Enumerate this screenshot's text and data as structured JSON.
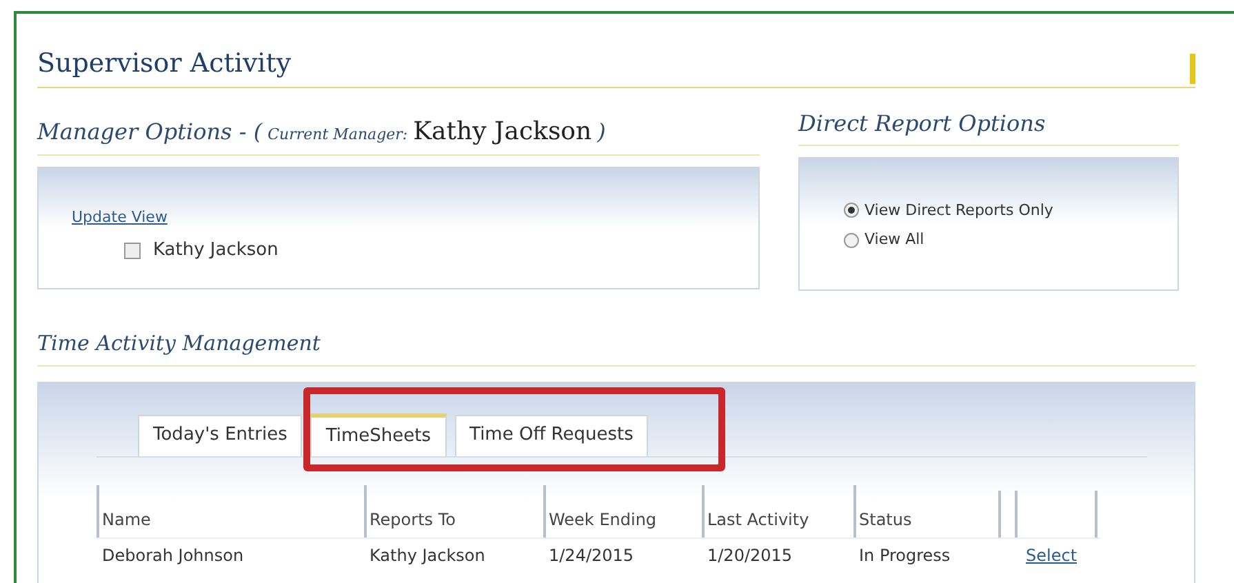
{
  "title": "Supervisor Activity",
  "manager_options": {
    "heading": "Manager Options - (",
    "current_label": "Current Manager:",
    "current_name": "Kathy Jackson",
    "close": ")",
    "link": "Update View",
    "managers": [
      {
        "label": "Kathy Jackson",
        "checked": false
      }
    ]
  },
  "direct_report_options": {
    "heading": "Direct Report Options",
    "options": [
      {
        "label": "View Direct Reports Only",
        "selected": true
      },
      {
        "label": "View All",
        "selected": false
      }
    ]
  },
  "time_activity": {
    "heading": "Time Activity Management",
    "tabs": [
      {
        "label": "Today's Entries",
        "selected": false
      },
      {
        "label": "TimeSheets",
        "selected": true
      },
      {
        "label": "Time Off Requests",
        "selected": false
      }
    ],
    "columns": [
      "Name",
      "Reports To",
      "Week Ending",
      "Last Activity",
      "Status"
    ],
    "rows": [
      {
        "cells": [
          "Deborah Johnson",
          "Kathy Jackson",
          "1/24/2015",
          "1/20/2015",
          "In Progress"
        ],
        "action": "Select"
      }
    ]
  }
}
